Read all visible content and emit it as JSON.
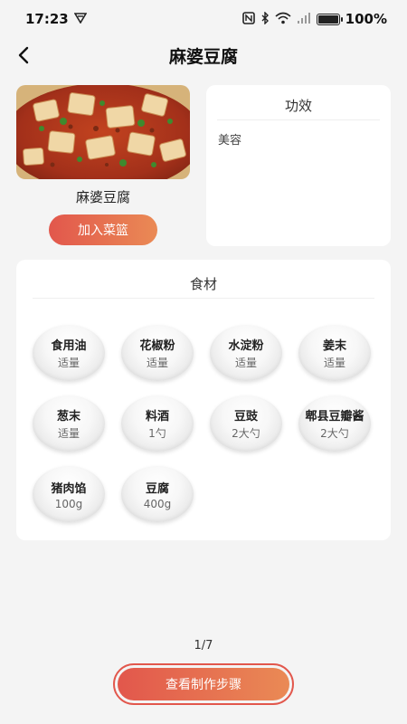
{
  "status_bar": {
    "time": "17:23",
    "battery": "100%"
  },
  "header": {
    "title": "麻婆豆腐"
  },
  "dish": {
    "name": "麻婆豆腐",
    "add_button": "加入菜篮"
  },
  "effect": {
    "title": "功效",
    "text": "美容"
  },
  "ingredients": {
    "title": "食材",
    "items": [
      {
        "name": "食用油",
        "amount": "适量"
      },
      {
        "name": "花椒粉",
        "amount": "适量"
      },
      {
        "name": "水淀粉",
        "amount": "适量"
      },
      {
        "name": "姜末",
        "amount": "适量"
      },
      {
        "name": "葱末",
        "amount": "适量"
      },
      {
        "name": "料酒",
        "amount": "1勺"
      },
      {
        "name": "豆豉",
        "amount": "2大勺"
      },
      {
        "name": "郫县豆瓣酱",
        "amount": "2大勺"
      },
      {
        "name": "猪肉馅",
        "amount": "100g"
      },
      {
        "name": "豆腐",
        "amount": "400g"
      }
    ]
  },
  "footer": {
    "pager": "1/7",
    "steps_button": "查看制作步骤"
  }
}
